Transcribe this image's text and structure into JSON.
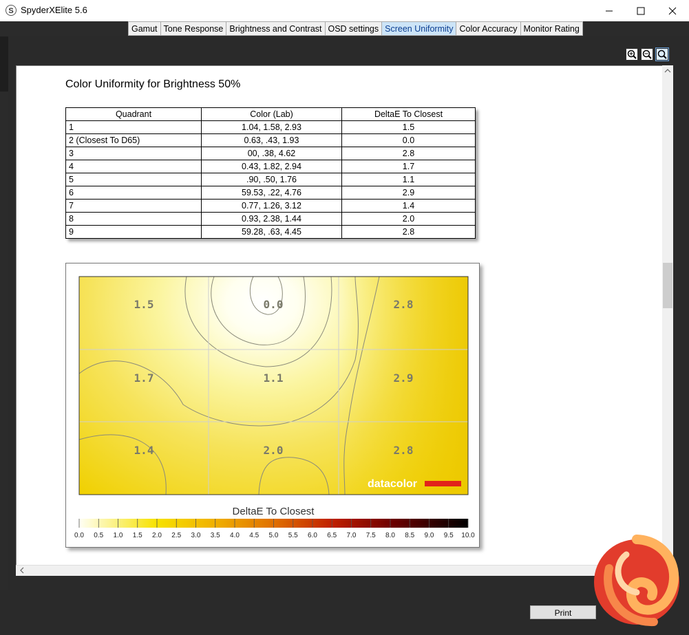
{
  "window": {
    "title": "SpyderXElite 5.6",
    "icon_letter": "S",
    "minimize": "—",
    "maximize": "☐",
    "close": "✕"
  },
  "tabs": [
    {
      "label": "Gamut"
    },
    {
      "label": "Tone Response"
    },
    {
      "label": "Brightness and Contrast"
    },
    {
      "label": "OSD settings"
    },
    {
      "label": "Screen Uniformity",
      "active": true
    },
    {
      "label": "Color Accuracy"
    },
    {
      "label": "Monitor Rating"
    }
  ],
  "report": {
    "title": "Color Uniformity for Brightness 50%",
    "table": {
      "headers": [
        "Quadrant",
        "Color (Lab)",
        "DeltaE To Closest"
      ],
      "rows": [
        [
          "1",
          "1.04,   1.58,   2.93",
          "1.5"
        ],
        [
          "2 (Closest To D65)",
          "0.63,    .43,   1.93",
          "0.0"
        ],
        [
          "3",
          "00,    .38,   4.62",
          "2.8"
        ],
        [
          "4",
          "0.43,   1.82,   2.94",
          "1.7"
        ],
        [
          "5",
          ".90,    .50,   1.76",
          "1.1"
        ],
        [
          "6",
          "59.53,    .22,   4.76",
          "2.9"
        ],
        [
          "7",
          "0.77,   1.26,   3.12",
          "1.4"
        ],
        [
          "8",
          "0.93,   2.38,   1.44",
          "2.0"
        ],
        [
          "9",
          "59.28,    .63,   4.45",
          "2.8"
        ]
      ]
    }
  },
  "chart_data": {
    "type": "heatmap",
    "title": "DeltaE To Closest",
    "grid_values": [
      [
        "1.5",
        "0.0",
        "2.8"
      ],
      [
        "1.7",
        "1.1",
        "2.9"
      ],
      [
        "1.4",
        "2.0",
        "2.8"
      ]
    ],
    "colorbar_ticks": [
      "0.0",
      "0.5",
      "1.0",
      "1.5",
      "2.0",
      "2.5",
      "3.0",
      "3.5",
      "4.0",
      "4.5",
      "5.0",
      "5.5",
      "6.0",
      "6.5",
      "7.0",
      "7.5",
      "8.0",
      "8.5",
      "9.0",
      "9.5",
      "10.0"
    ],
    "colorbar_range": [
      0,
      10
    ],
    "logo_text": "datacolor",
    "colors": {
      "low": "#fffff2",
      "mid": "#f0d200",
      "high": "#000000"
    }
  },
  "buttons": {
    "print": "Print"
  }
}
